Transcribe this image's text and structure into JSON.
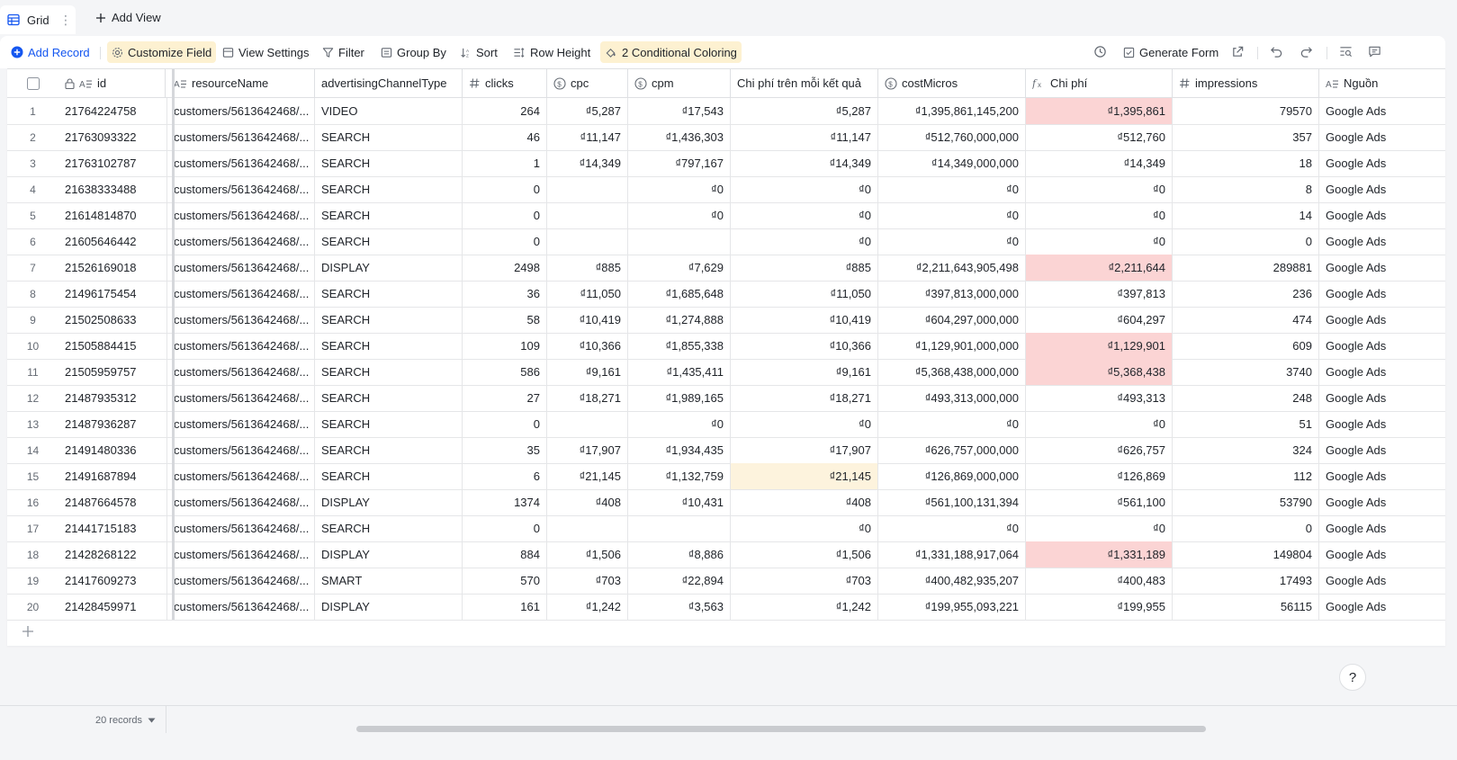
{
  "tabs": {
    "grid_label": "Grid",
    "add_view_label": "Add View"
  },
  "toolbar": {
    "add_record": "Add Record",
    "customize_field": "Customize Field",
    "view_settings": "View Settings",
    "filter": "Filter",
    "group_by": "Group By",
    "sort": "Sort",
    "row_height": "Row Height",
    "conditional_coloring": "2 Conditional Coloring",
    "generate_form": "Generate Form"
  },
  "colors": {
    "accent": "#1456f0",
    "highlight_red": "#fbd4d4",
    "highlight_yellow": "#fdf3dd",
    "active_button": "#fdf1d1"
  },
  "columns": [
    {
      "key": "id",
      "label": "id",
      "icon": "text-icon"
    },
    {
      "key": "resourceName",
      "label": "resourceName",
      "icon": "text-icon"
    },
    {
      "key": "advertisingChannelType",
      "label": "advertisingChannelType",
      "icon": "none"
    },
    {
      "key": "clicks",
      "label": "clicks",
      "icon": "number-icon"
    },
    {
      "key": "cpc",
      "label": "cpc",
      "icon": "currency-icon"
    },
    {
      "key": "cpm",
      "label": "cpm",
      "icon": "currency-icon"
    },
    {
      "key": "cost_per_result",
      "label": "Chi phí trên mỗi kết quả",
      "icon": "none"
    },
    {
      "key": "costMicros",
      "label": "costMicros",
      "icon": "currency-icon"
    },
    {
      "key": "chi_phi",
      "label": "Chi phí",
      "icon": "formula-icon"
    },
    {
      "key": "impressions",
      "label": "impressions",
      "icon": "number-icon"
    },
    {
      "key": "nguon",
      "label": "Nguồn",
      "icon": "text-icon"
    }
  ],
  "rows": [
    {
      "n": "1",
      "id": "21764224758",
      "res": "customers/5613642468/...",
      "type": "VIDEO",
      "clicks": "264",
      "cpc": "₫5,287",
      "cpm": "₫17,543",
      "cpr": "₫5,287",
      "cm": "₫1,395,861,145,200",
      "cp": "₫1,395,861",
      "imp": "79570",
      "src": "Google Ads"
    },
    {
      "n": "2",
      "id": "21763093322",
      "res": "customers/5613642468/...",
      "type": "SEARCH",
      "clicks": "46",
      "cpc": "₫11,147",
      "cpm": "₫1,436,303",
      "cpr": "₫11,147",
      "cm": "₫512,760,000,000",
      "cp": "₫512,760",
      "imp": "357",
      "src": "Google Ads"
    },
    {
      "n": "3",
      "id": "21763102787",
      "res": "customers/5613642468/...",
      "type": "SEARCH",
      "clicks": "1",
      "cpc": "₫14,349",
      "cpm": "₫797,167",
      "cpr": "₫14,349",
      "cm": "₫14,349,000,000",
      "cp": "₫14,349",
      "imp": "18",
      "src": "Google Ads"
    },
    {
      "n": "4",
      "id": "21638333488",
      "res": "customers/5613642468/...",
      "type": "SEARCH",
      "clicks": "0",
      "cpc": "",
      "cpm": "₫0",
      "cpr": "₫0",
      "cm": "₫0",
      "cp": "₫0",
      "imp": "8",
      "src": "Google Ads"
    },
    {
      "n": "5",
      "id": "21614814870",
      "res": "customers/5613642468/...",
      "type": "SEARCH",
      "clicks": "0",
      "cpc": "",
      "cpm": "₫0",
      "cpr": "₫0",
      "cm": "₫0",
      "cp": "₫0",
      "imp": "14",
      "src": "Google Ads"
    },
    {
      "n": "6",
      "id": "21605646442",
      "res": "customers/5613642468/...",
      "type": "SEARCH",
      "clicks": "0",
      "cpc": "",
      "cpm": "",
      "cpr": "₫0",
      "cm": "₫0",
      "cp": "₫0",
      "imp": "0",
      "src": "Google Ads"
    },
    {
      "n": "7",
      "id": "21526169018",
      "res": "customers/5613642468/...",
      "type": "DISPLAY",
      "clicks": "2498",
      "cpc": "₫885",
      "cpm": "₫7,629",
      "cpr": "₫885",
      "cm": "₫2,211,643,905,498",
      "cp": "₫2,211,644",
      "imp": "289881",
      "src": "Google Ads"
    },
    {
      "n": "8",
      "id": "21496175454",
      "res": "customers/5613642468/...",
      "type": "SEARCH",
      "clicks": "36",
      "cpc": "₫11,050",
      "cpm": "₫1,685,648",
      "cpr": "₫11,050",
      "cm": "₫397,813,000,000",
      "cp": "₫397,813",
      "imp": "236",
      "src": "Google Ads"
    },
    {
      "n": "9",
      "id": "21502508633",
      "res": "customers/5613642468/...",
      "type": "SEARCH",
      "clicks": "58",
      "cpc": "₫10,419",
      "cpm": "₫1,274,888",
      "cpr": "₫10,419",
      "cm": "₫604,297,000,000",
      "cp": "₫604,297",
      "imp": "474",
      "src": "Google Ads"
    },
    {
      "n": "10",
      "id": "21505884415",
      "res": "customers/5613642468/...",
      "type": "SEARCH",
      "clicks": "109",
      "cpc": "₫10,366",
      "cpm": "₫1,855,338",
      "cpr": "₫10,366",
      "cm": "₫1,129,901,000,000",
      "cp": "₫1,129,901",
      "imp": "609",
      "src": "Google Ads"
    },
    {
      "n": "11",
      "id": "21505959757",
      "res": "customers/5613642468/...",
      "type": "SEARCH",
      "clicks": "586",
      "cpc": "₫9,161",
      "cpm": "₫1,435,411",
      "cpr": "₫9,161",
      "cm": "₫5,368,438,000,000",
      "cp": "₫5,368,438",
      "imp": "3740",
      "src": "Google Ads"
    },
    {
      "n": "12",
      "id": "21487935312",
      "res": "customers/5613642468/...",
      "type": "SEARCH",
      "clicks": "27",
      "cpc": "₫18,271",
      "cpm": "₫1,989,165",
      "cpr": "₫18,271",
      "cm": "₫493,313,000,000",
      "cp": "₫493,313",
      "imp": "248",
      "src": "Google Ads"
    },
    {
      "n": "13",
      "id": "21487936287",
      "res": "customers/5613642468/...",
      "type": "SEARCH",
      "clicks": "0",
      "cpc": "",
      "cpm": "₫0",
      "cpr": "₫0",
      "cm": "₫0",
      "cp": "₫0",
      "imp": "51",
      "src": "Google Ads"
    },
    {
      "n": "14",
      "id": "21491480336",
      "res": "customers/5613642468/...",
      "type": "SEARCH",
      "clicks": "35",
      "cpc": "₫17,907",
      "cpm": "₫1,934,435",
      "cpr": "₫17,907",
      "cm": "₫626,757,000,000",
      "cp": "₫626,757",
      "imp": "324",
      "src": "Google Ads"
    },
    {
      "n": "15",
      "id": "21491687894",
      "res": "customers/5613642468/...",
      "type": "SEARCH",
      "clicks": "6",
      "cpc": "₫21,145",
      "cpm": "₫1,132,759",
      "cpr": "₫21,145",
      "cm": "₫126,869,000,000",
      "cp": "₫126,869",
      "imp": "112",
      "src": "Google Ads"
    },
    {
      "n": "16",
      "id": "21487664578",
      "res": "customers/5613642468/...",
      "type": "DISPLAY",
      "clicks": "1374",
      "cpc": "₫408",
      "cpm": "₫10,431",
      "cpr": "₫408",
      "cm": "₫561,100,131,394",
      "cp": "₫561,100",
      "imp": "53790",
      "src": "Google Ads"
    },
    {
      "n": "17",
      "id": "21441715183",
      "res": "customers/5613642468/...",
      "type": "SEARCH",
      "clicks": "0",
      "cpc": "",
      "cpm": "",
      "cpr": "₫0",
      "cm": "₫0",
      "cp": "₫0",
      "imp": "0",
      "src": "Google Ads"
    },
    {
      "n": "18",
      "id": "21428268122",
      "res": "customers/5613642468/...",
      "type": "DISPLAY",
      "clicks": "884",
      "cpc": "₫1,506",
      "cpm": "₫8,886",
      "cpr": "₫1,506",
      "cm": "₫1,331,188,917,064",
      "cp": "₫1,331,189",
      "imp": "149804",
      "src": "Google Ads"
    },
    {
      "n": "19",
      "id": "21417609273",
      "res": "customers/5613642468/...",
      "type": "SMART",
      "clicks": "570",
      "cpc": "₫703",
      "cpm": "₫22,894",
      "cpr": "₫703",
      "cm": "₫400,482,935,207",
      "cp": "₫400,483",
      "imp": "17493",
      "src": "Google Ads"
    },
    {
      "n": "20",
      "id": "21428459971",
      "res": "customers/5613642468/...",
      "type": "DISPLAY",
      "clicks": "161",
      "cpc": "₫1,242",
      "cpm": "₫3,563",
      "cpr": "₫1,242",
      "cm": "₫199,955,093,221",
      "cp": "₫199,955",
      "imp": "56115",
      "src": "Google Ads"
    }
  ],
  "highlights": {
    "chi_phi_red_rows": [
      1,
      7,
      10,
      11,
      18
    ],
    "cost_per_result_yellow_rows": [
      15
    ]
  },
  "footer": {
    "record_count": "20 records",
    "help_glyph": "?"
  }
}
